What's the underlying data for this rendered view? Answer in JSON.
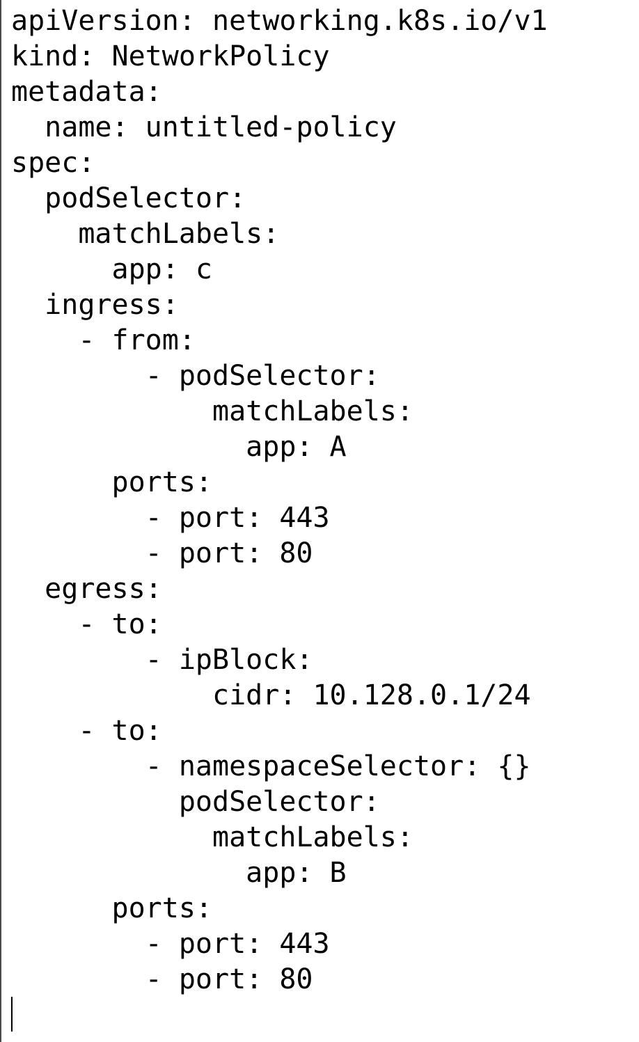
{
  "editor": {
    "lines": [
      "apiVersion: networking.k8s.io/v1",
      "kind: NetworkPolicy",
      "metadata:",
      "  name: untitled-policy",
      "spec:",
      "  podSelector:",
      "    matchLabels:",
      "      app: c",
      "  ingress:",
      "    - from:",
      "        - podSelector:",
      "            matchLabels:",
      "              app: A",
      "      ports:",
      "        - port: 443",
      "        - port: 80",
      "  egress:",
      "    - to:",
      "        - ipBlock:",
      "            cidr: 10.128.0.1/24",
      "    - to:",
      "        - namespaceSelector: {}",
      "          podSelector:",
      "            matchLabels:",
      "              app: B",
      "      ports:",
      "        - port: 443",
      "        - port: 80"
    ]
  }
}
